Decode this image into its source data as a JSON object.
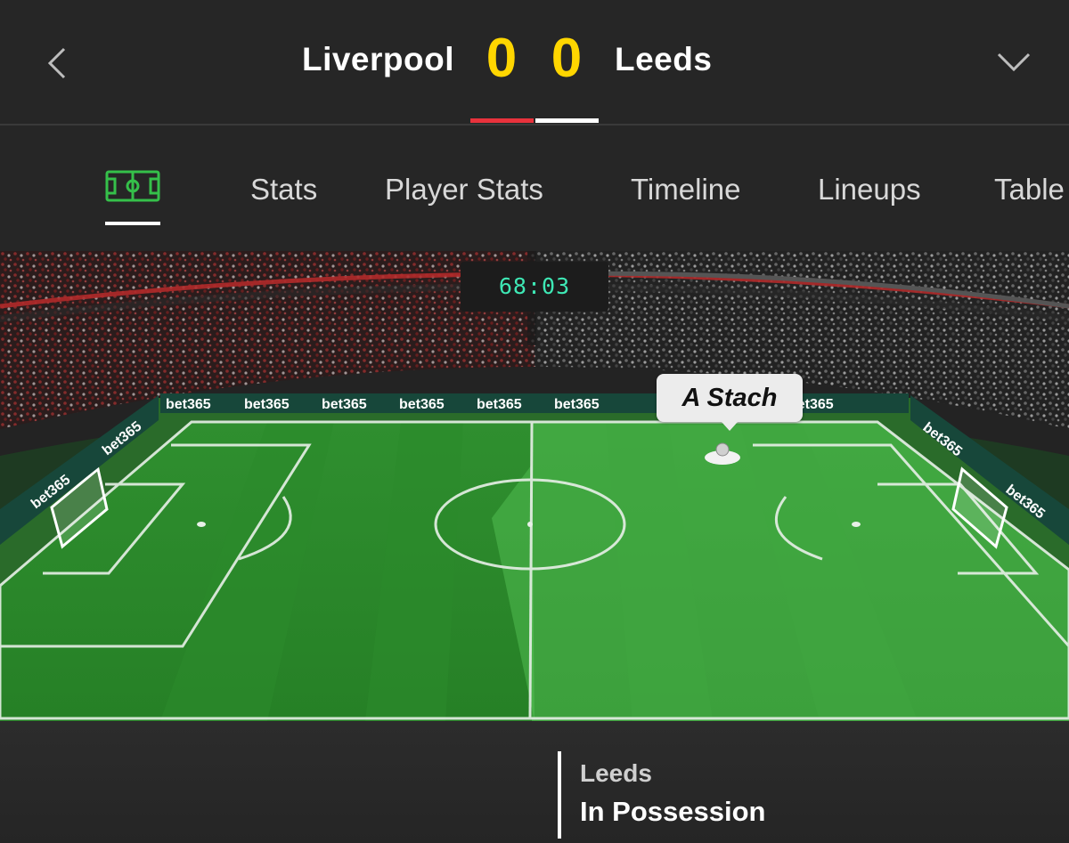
{
  "header": {
    "home_team": "Liverpool",
    "away_team": "Leeds",
    "home_score": "0",
    "away_score": "0",
    "home_color": "#e8323c",
    "away_color": "#ffffff",
    "score_color": "#ffd600",
    "back_icon": "chevron-left-icon",
    "expand_icon": "chevron-down-icon"
  },
  "tabs": {
    "pitch_icon": "pitch-icon",
    "items": [
      "Stats",
      "Player Stats",
      "Timeline",
      "Lineups",
      "Table"
    ]
  },
  "field": {
    "clock": "68:03",
    "player_name": "A Stach",
    "sponsor": "bet365"
  },
  "possession": {
    "team": "Leeds",
    "label": "In Possession"
  }
}
